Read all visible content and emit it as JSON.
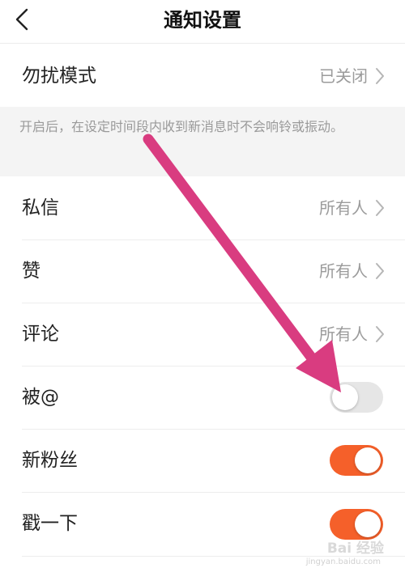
{
  "header": {
    "title": "通知设置",
    "back_icon": "chevron-left-icon"
  },
  "dnd": {
    "label": "勿扰模式",
    "value": "已关闭"
  },
  "dnd_description": "开启后，在设定时间段内收到新消息时不会响铃或振动。",
  "settings": [
    {
      "label": "私信",
      "value": "所有人"
    },
    {
      "label": "赞",
      "value": "所有人"
    },
    {
      "label": "评论",
      "value": "所有人"
    }
  ],
  "toggles": [
    {
      "label": "被@",
      "on": false
    },
    {
      "label": "新粉丝",
      "on": true
    },
    {
      "label": "戳一下",
      "on": true
    }
  ],
  "colors": {
    "toggle_on": "#f5602a",
    "toggle_off": "#e6e6e6",
    "annotation_arrow": "#d93c80"
  },
  "watermark": {
    "text": "Bai 经验",
    "sub": "jingyan.baidu.com"
  }
}
